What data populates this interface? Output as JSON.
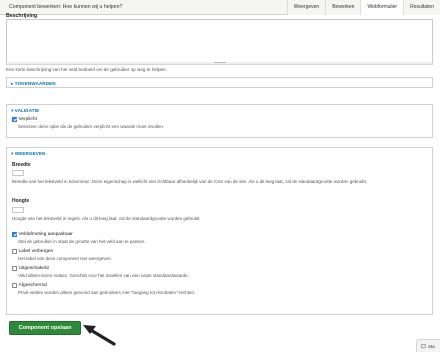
{
  "header": {
    "title": "Component bewerken: Hoe kunnen wij u helpen?",
    "tabs": [
      {
        "label": "Weergeven"
      },
      {
        "label": "Bewerken"
      },
      {
        "label": "Webformulier",
        "active": true
      },
      {
        "label": "Resultaten"
      }
    ]
  },
  "description": {
    "label": "Beschrijving",
    "help": "Een korte beschrijving van het veld bedoeld om de gebruiker op weg te helpen."
  },
  "tokenwaarden": {
    "legend": "▸ TOKENWAARDEN"
  },
  "validatie": {
    "legend": "▾ VALIDATIE",
    "verplicht_label": "Verplicht",
    "verplicht_checked": true,
    "verplicht_desc": "Selecteer deze optie als de gebruiker verplicht een waarde moet invullen."
  },
  "weergeven": {
    "legend": "▾ WEERGEVEN",
    "breedte_label": "Breedte",
    "breedte_desc": "Breedte van het tekstveld in kolommen. Deze eigenschap is wellicht niet zichtbaar afhankelijk van de CSS van de site. Als u dit leeg laat, zal de standaardgrootte worden gebruikt.",
    "hoogte_label": "Hoogte",
    "hoogte_desc": "Hoogte van het tekstveld in regels. Als u dit leeg laat, zal de standaardgrootte worden gebruikt.",
    "options": [
      {
        "label": "Veldafmeting aanpasbaar",
        "desc": "Stel de gebruiker in staat de grootte van het veld aan te passen.",
        "checked": true
      },
      {
        "label": "Label verbergen",
        "desc": "Het label van deze component niet weergeven.",
        "checked": false
      },
      {
        "label": "Uitgeschakeld",
        "desc": "Veld alleen-lezen maken. Geschikt voor het instellen van een vaste standaardwaarde.",
        "checked": false
      },
      {
        "label": "Afgeschermd",
        "desc": "Privé-velden worden alleen getoond aan gebruikers met \"toegang tot resultaten\"-rechten.",
        "checked": false
      }
    ]
  },
  "actions": {
    "save_label": "Component opslaan"
  },
  "chat": {
    "label": "Sta"
  },
  "colors": {
    "accent_blue": "#0071b3",
    "save_green": "#2e8a3a",
    "checkbox_blue": "#1c7ed6"
  }
}
